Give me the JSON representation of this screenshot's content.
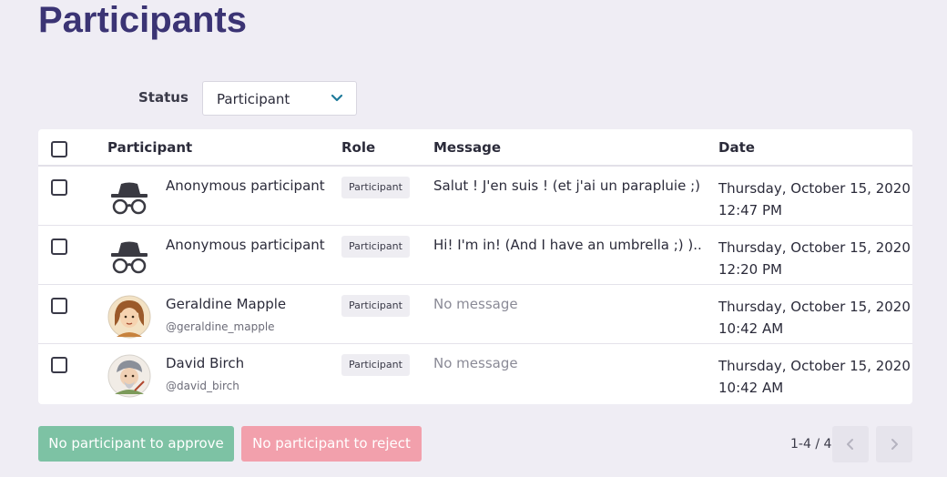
{
  "page": {
    "title": "Participants"
  },
  "filter": {
    "label": "Status",
    "value": "Participant"
  },
  "table": {
    "headers": {
      "participant": "Participant",
      "role": "Role",
      "message": "Message",
      "date": "Date"
    },
    "rows": [
      {
        "name": "Anonymous participant",
        "handle": "",
        "avatar": "incognito-icon",
        "role": "Participant",
        "message": "Salut ! J'en suis ! (et j'ai un parapluie ;) )...",
        "message_empty": false,
        "date": "Thursday, October 15, 2020",
        "time": "12:47 PM"
      },
      {
        "name": "Anonymous participant",
        "handle": "",
        "avatar": "incognito-icon",
        "role": "Participant",
        "message": "Hi! I'm in! (And I have an umbrella ;) )...",
        "message_empty": false,
        "date": "Thursday, October 15, 2020",
        "time": "12:20 PM"
      },
      {
        "name": "Geraldine Mapple",
        "handle": "@geraldine_mapple",
        "avatar": "user-avatar",
        "role": "Participant",
        "message": "No message",
        "message_empty": true,
        "date": "Thursday, October 15, 2020",
        "time": "10:42 AM"
      },
      {
        "name": "David Birch",
        "handle": "@david_birch",
        "avatar": "user-avatar",
        "role": "Participant",
        "message": "No message",
        "message_empty": true,
        "date": "Thursday, October 15, 2020",
        "time": "10:42 AM"
      }
    ]
  },
  "actions": {
    "approve_label": "No participant to approve",
    "reject_label": "No participant to reject"
  },
  "pagination": {
    "info": "1-4 / 4"
  },
  "colors": {
    "title": "#3b3474",
    "approve": "#7dc2a4",
    "reject": "#f2a0ac",
    "background": "#efedf4",
    "chevron": "#1e7a9a"
  }
}
